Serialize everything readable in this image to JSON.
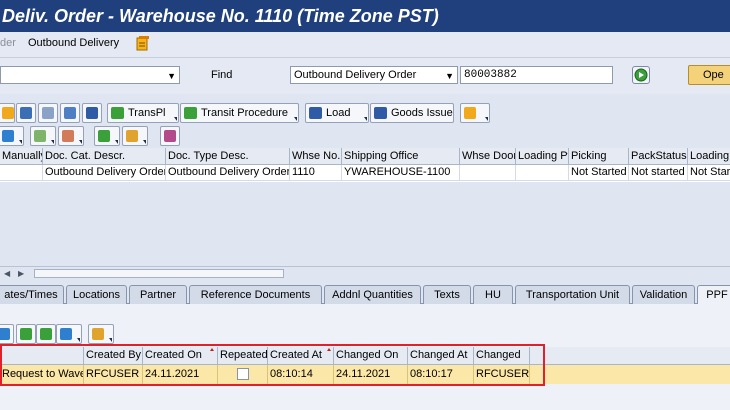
{
  "window": {
    "title": "Deliv. Order - Warehouse No. 1110 (Time Zone PST)"
  },
  "menu": {
    "items": [
      {
        "label": "der",
        "disabled": true
      },
      {
        "label": "Outbound Delivery",
        "disabled": false
      }
    ]
  },
  "find": {
    "left_combo_value": "",
    "label": "Find",
    "type_value": "Outbound Delivery Order",
    "number_value": "80003882",
    "open_label": "Ope"
  },
  "toolbar": {
    "transpl_label": "TransPl",
    "transit_label": "Transit Procedure",
    "load_label": "Load",
    "goods_issue_label": "Goods Issue"
  },
  "main_table": {
    "columns": [
      "Manually",
      "Doc. Cat. Descr.",
      "Doc. Type Desc.",
      "Whse No.",
      "Shipping Office",
      "Whse Door",
      "Loading Pt",
      "Picking",
      "PackStatus",
      "Loading"
    ],
    "rows": [
      [
        "",
        "Outbound Delivery Order",
        "Outbound Delivery Order",
        "1110",
        "YWAREHOUSE-1100",
        "",
        "",
        "Not Started",
        "Not started",
        "Not Star"
      ]
    ]
  },
  "tabs": [
    {
      "label": "ates/Times"
    },
    {
      "label": "Locations"
    },
    {
      "label": "Partner"
    },
    {
      "label": "Reference Documents"
    },
    {
      "label": "Addnl Quantities"
    },
    {
      "label": "Texts"
    },
    {
      "label": "HU"
    },
    {
      "label": "Transportation Unit"
    },
    {
      "label": "Validation"
    },
    {
      "label": "PPF",
      "active": true
    }
  ],
  "ppf_table": {
    "columns": [
      "",
      "Created By",
      "Created On",
      "Repeated",
      "Created At",
      "Changed On",
      "Changed At",
      "Changed"
    ],
    "rows": [
      [
        "Request to Wave",
        "RFCUSER",
        "24.11.2021",
        "",
        "08:10:14",
        "24.11.2021",
        "08:10:17",
        "RFCUSER"
      ]
    ],
    "repeated_checked": false
  },
  "colors": {
    "title_bar": "#1f3f7d",
    "selected_row": "#fbe7a7",
    "highlight_border": "#e0202a",
    "background": "#dfe6f1"
  }
}
